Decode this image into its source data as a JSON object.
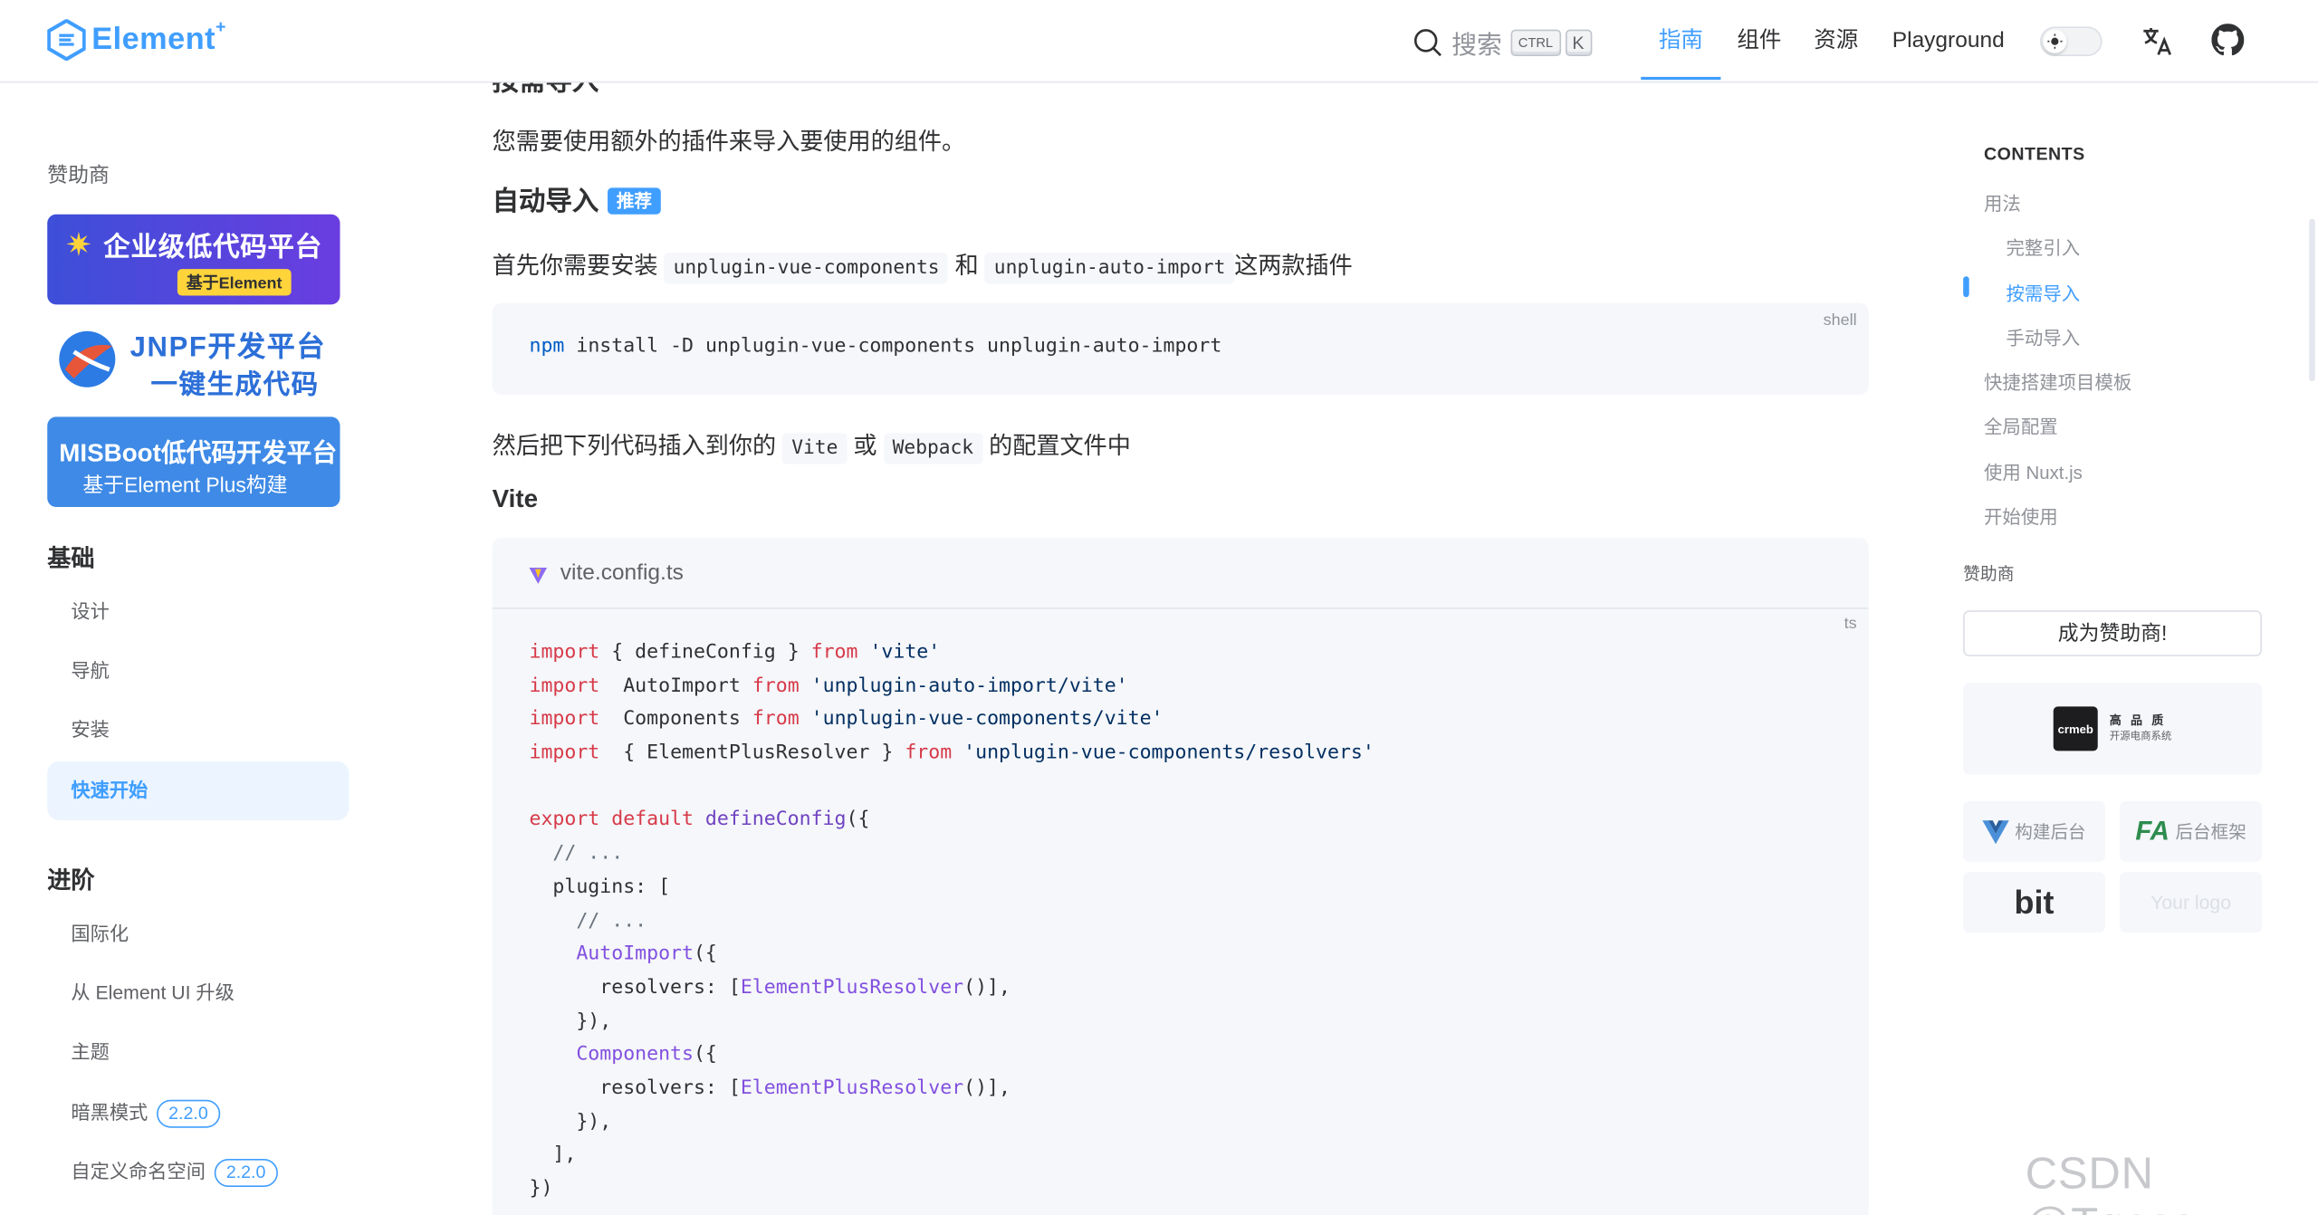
{
  "header": {
    "logo_text": "Element",
    "logo_plus": "+",
    "search_label": "搜索",
    "kbd_ctrl": "CTRL",
    "kbd_k": "K",
    "nav": [
      "指南",
      "组件",
      "资源",
      "Playground"
    ],
    "active_nav": "指南"
  },
  "sidebar": {
    "sponsor_title": "赞助商",
    "banner1_title": "企业级低代码平台",
    "banner1_sub": "基于Element",
    "banner2_title": "JNPF开发平台",
    "banner2_sub": "一键生成代码",
    "banner3_title": "MISBoot低代码开发平台",
    "banner3_sub": "基于Element Plus构建",
    "group1": "基础",
    "items1": [
      "设计",
      "导航",
      "安装",
      "快速开始"
    ],
    "group2": "进阶",
    "items2": [
      "国际化",
      "从 Element UI 升级",
      "主题",
      "暗黑模式",
      "自定义命名空间"
    ],
    "ver1": "2.2.0",
    "ver2": "2.2.0"
  },
  "main": {
    "cut_heading": "按需导入",
    "p1": "您需要使用额外的插件来导入要使用的组件。",
    "h_auto": "自动导入",
    "tag_rec": "推荐",
    "p2_pre": "首先你需要安装",
    "p2_code1": "unplugin-vue-components",
    "p2_mid": "和",
    "p2_code2": "unplugin-auto-import",
    "p2_post": "这两款插件",
    "shell_lang": "shell",
    "shell_cmd": "npm",
    "shell_args": " install -D unplugin-vue-components unplugin-auto-import",
    "p3_pre": "然后把下列代码插入到你的",
    "p3_code1": "Vite",
    "p3_mid": "或",
    "p3_code2": "Webpack",
    "p3_post": "的配置文件中",
    "h_vite": "Vite",
    "file_name": "vite.config.ts",
    "ts_lang": "ts"
  },
  "toc": {
    "title": "CONTENTS",
    "items": [
      "用法",
      "完整引入",
      "按需导入",
      "手动导入",
      "快捷搭建项目模板",
      "全局配置",
      "使用 Nuxt.js",
      "开始使用"
    ],
    "active": "按需导入",
    "sponsor_label": "赞助商",
    "sponsor_btn": "成为赞助商!",
    "crmeb_name": "crmeb",
    "crmeb_t1": "高 品 质",
    "crmeb_t2": "开源电商系统",
    "sp1": "构建后台",
    "sp2": "后台框架",
    "sp3": "bit",
    "sp4": "Your logo"
  },
  "watermark": "CSDN @Tgess",
  "colors": {
    "brand": "#409eff",
    "keyword": "#d73a49",
    "string": "#032f62",
    "function": "#6f42c1",
    "comment": "#6a737d"
  }
}
